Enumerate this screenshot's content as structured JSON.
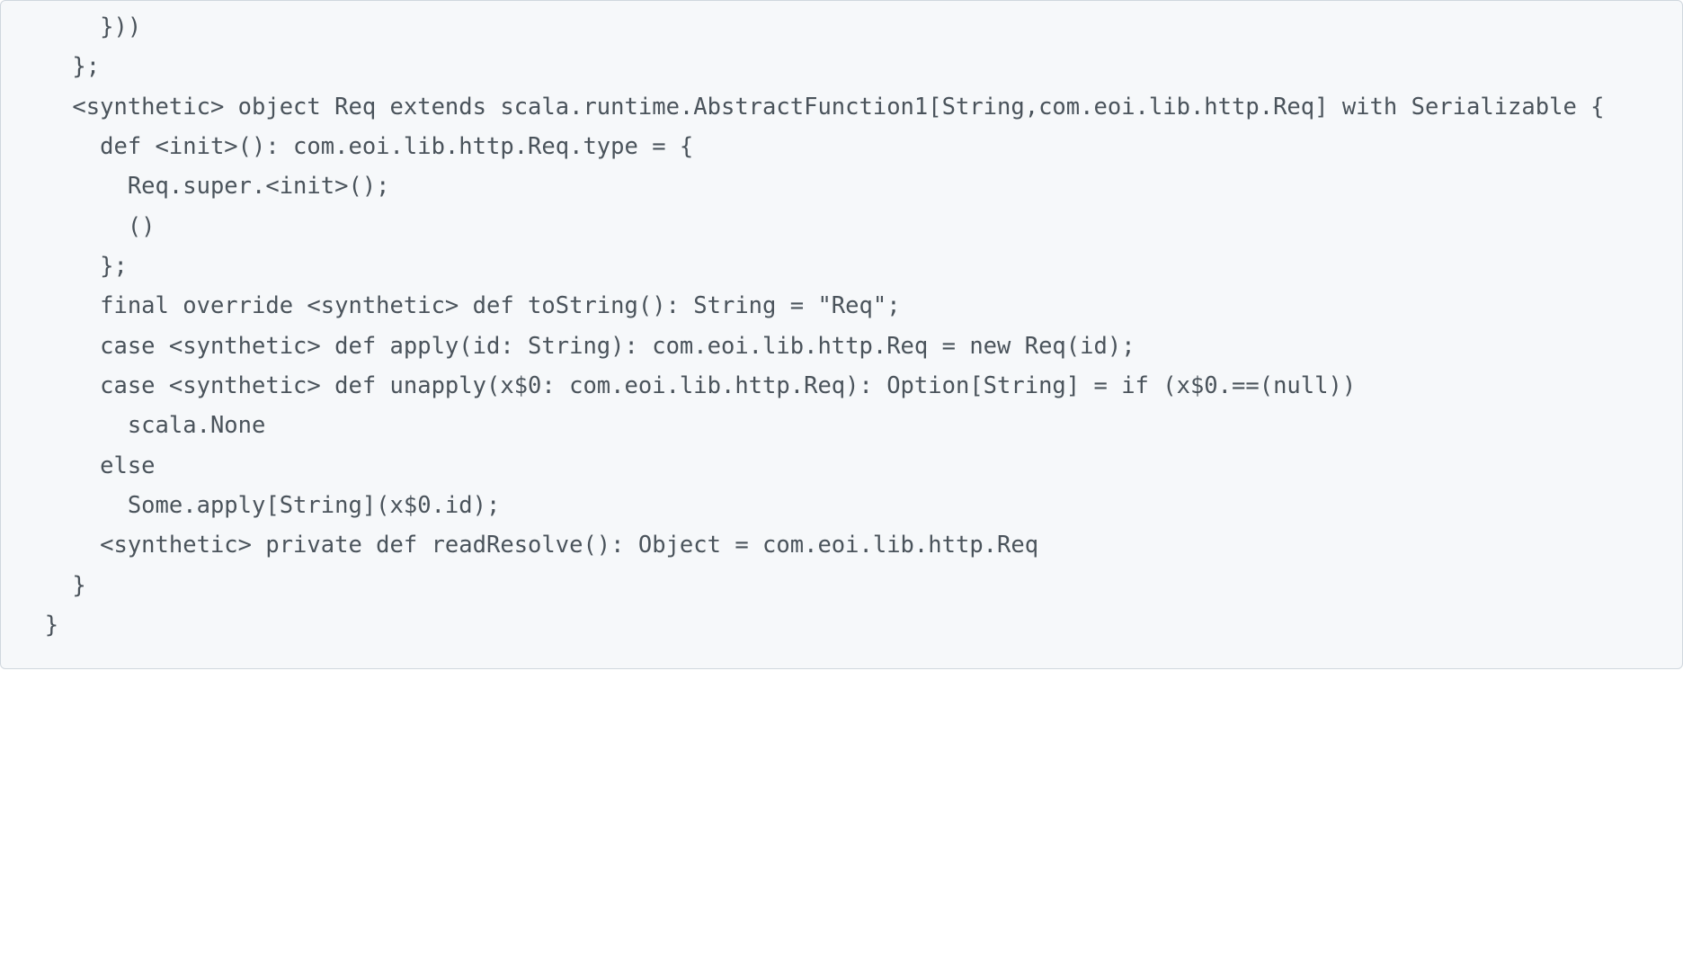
{
  "code": {
    "content": "      }))\n    };\n    <synthetic> object Req extends scala.runtime.AbstractFunction1[String,com.eoi.lib.http.Req] with Serializable {\n      def <init>(): com.eoi.lib.http.Req.type = {\n        Req.super.<init>();\n        ()\n      };\n      final override <synthetic> def toString(): String = \"Req\";\n      case <synthetic> def apply(id: String): com.eoi.lib.http.Req = new Req(id);\n      case <synthetic> def unapply(x$0: com.eoi.lib.http.Req): Option[String] = if (x$0.==(null))\n        scala.None\n      else\n        Some.apply[String](x$0.id);\n      <synthetic> private def readResolve(): Object = com.eoi.lib.http.Req\n    }\n  }"
  }
}
